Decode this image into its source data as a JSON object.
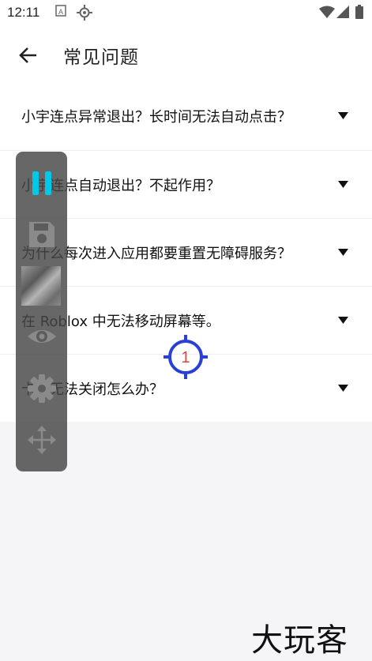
{
  "status_bar": {
    "time": "12:11",
    "icons": [
      "keyboard-a-icon",
      "gps-icon",
      "wifi-icon",
      "signal-icon",
      "battery-icon"
    ]
  },
  "app_bar": {
    "back_icon": "arrow-left-icon",
    "title": "常见问题"
  },
  "faq": {
    "items": [
      {
        "question": "小宇连点异常退出？长时间无法自动点击？"
      },
      {
        "question": "小宇连点自动退出？不起作用？"
      },
      {
        "question": "为什么每次进入应用都要重置无障碍服务？"
      },
      {
        "question": "在 Roblox 中无法移动屏幕等。"
      },
      {
        "question": "卡屏无法关闭怎么办？"
      }
    ],
    "expand_icon": "triangle-down-icon"
  },
  "floating_panel": {
    "icons": [
      "pause-icon",
      "save-icon",
      "thumbnail",
      "eye-icon",
      "gear-icon",
      "move-icon"
    ]
  },
  "click_target": {
    "number": "1"
  },
  "watermark": {
    "text": "大玩客"
  },
  "colors": {
    "accent_cyan": "#00c8e8",
    "target_blue": "#2a3fd6",
    "target_number_red": "#e0403a",
    "panel_bg": "#464646"
  }
}
